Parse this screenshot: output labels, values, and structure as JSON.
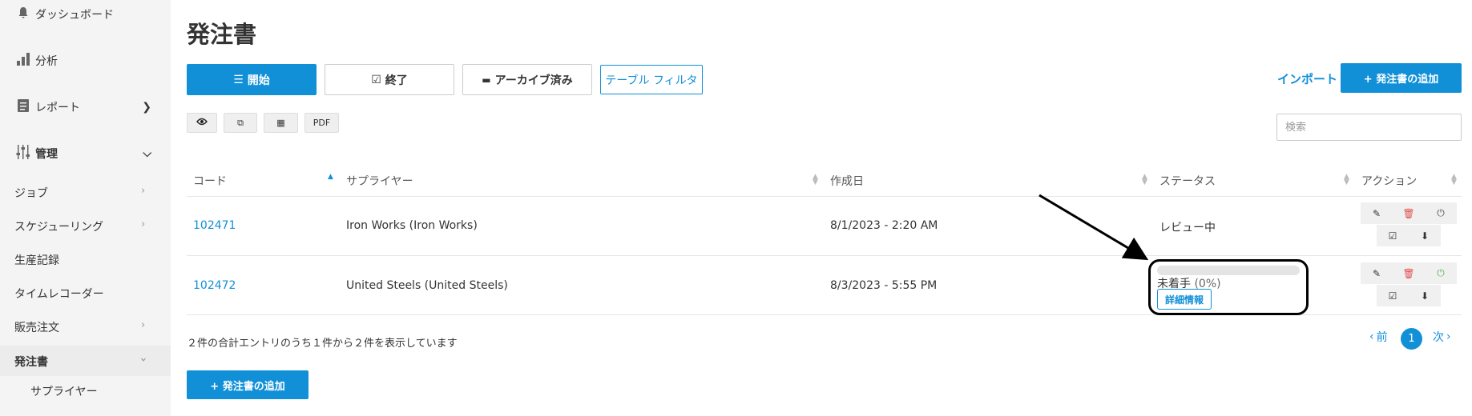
{
  "sidebar": {
    "items": [
      {
        "label": "ダッシュボード",
        "icon": "bell-icon"
      },
      {
        "label": "分析",
        "icon": "bar-chart-icon"
      },
      {
        "label": "レポート",
        "icon": "document-icon"
      },
      {
        "label": "管理",
        "icon": "sliders-icon"
      }
    ],
    "sub_items": [
      {
        "label": "ジョブ"
      },
      {
        "label": "スケジューリング"
      },
      {
        "label": "生産記録"
      },
      {
        "label": "タイムレコーダー"
      },
      {
        "label": "販売注文"
      },
      {
        "label": "発注書"
      },
      {
        "label": "サプライヤー"
      }
    ]
  },
  "page": {
    "title": "発注書"
  },
  "tabs": {
    "open": "開始",
    "closed": "終了",
    "archived": "アーカイブ済み",
    "table_filter": "テーブル フィルタ"
  },
  "toolbar": {
    "import": "インポート",
    "add_po": "+ 発注書の追加",
    "pdf": "PDF"
  },
  "search": {
    "placeholder": "検索"
  },
  "table": {
    "headers": {
      "code": "コード",
      "supplier": "サプライヤー",
      "created": "作成日",
      "status": "ステータス",
      "actions": "アクション"
    },
    "rows": [
      {
        "code": "102471",
        "supplier": "Iron Works (Iron Works)",
        "created": "8/1/2023 - 2:20 AM",
        "status": "レビュー中"
      },
      {
        "code": "102472",
        "supplier": "United Steels (United Steels)",
        "created": "8/3/2023 - 5:55 PM",
        "status": "未着手",
        "progress_percent": 0,
        "progress_label": "(0%)",
        "details_label": "詳細情報"
      }
    ]
  },
  "footer": {
    "summary": "２件の合計エントリのうち１件から２件を表示しています",
    "prev": "前",
    "page": "1",
    "next": "次",
    "add_po": "+ 発注書の追加"
  },
  "colors": {
    "accent": "#1190d8",
    "delete": "#e05050",
    "power_active": "#5cb85c"
  }
}
